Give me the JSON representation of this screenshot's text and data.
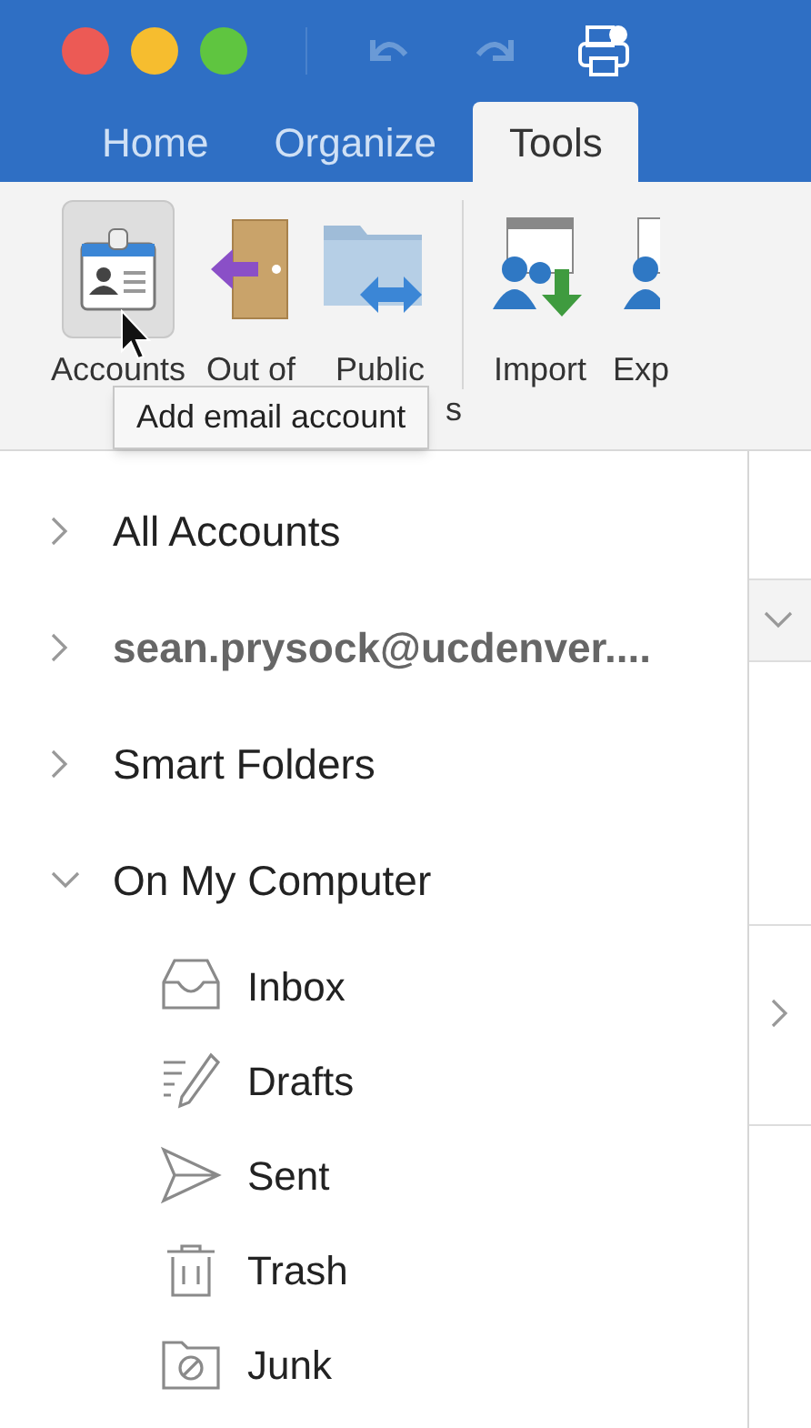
{
  "tabs": [
    {
      "label": "Home",
      "selected": false
    },
    {
      "label": "Organize",
      "selected": false
    },
    {
      "label": "Tools",
      "selected": true
    }
  ],
  "ribbon": [
    {
      "kind": "accounts",
      "label": "Accounts",
      "pressed": true
    },
    {
      "kind": "door",
      "label": "Out of",
      "pressed": false
    },
    {
      "kind": "public",
      "label": "Public",
      "label_tail": "s",
      "pressed": false
    },
    {
      "kind": "import",
      "label": "Import",
      "pressed": false
    },
    {
      "kind": "export",
      "label": "Exp",
      "pressed": false
    }
  ],
  "tooltip": "Add email account",
  "sidebar": {
    "items": [
      {
        "label": "All Accounts",
        "expanded": false,
        "bold": false
      },
      {
        "label": "sean.prysock@ucdenver....",
        "expanded": false,
        "bold": true
      },
      {
        "label": "Smart Folders",
        "expanded": false,
        "bold": false
      },
      {
        "label": "On My Computer",
        "expanded": true,
        "bold": false,
        "children": [
          {
            "label": "Inbox",
            "kind": "inbox"
          },
          {
            "label": "Drafts",
            "kind": "drafts"
          },
          {
            "label": "Sent",
            "kind": "sent"
          },
          {
            "label": "Trash",
            "kind": "trash"
          },
          {
            "label": "Junk",
            "kind": "junk"
          }
        ]
      }
    ]
  }
}
